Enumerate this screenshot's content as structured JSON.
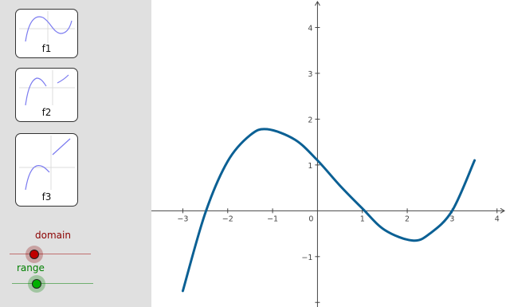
{
  "buttons": [
    {
      "label": "f1"
    },
    {
      "label": "f2"
    },
    {
      "label": "f3"
    }
  ],
  "sliders": {
    "domain": {
      "label": "domain",
      "color": "#8b0000",
      "fill": "#c00000"
    },
    "range": {
      "label": "range",
      "color": "#008000",
      "fill": "#00b000"
    }
  },
  "chart_data": {
    "type": "line",
    "title": "",
    "xlabel": "",
    "ylabel": "",
    "xlim": [
      -3.7,
      4.2
    ],
    "ylim": [
      -2.1,
      4.6
    ],
    "xticks": [
      -3,
      -2,
      -1,
      0,
      1,
      2,
      3,
      4
    ],
    "xtick_labels": [
      "−3",
      "−2",
      "−1",
      "0",
      "1",
      "2",
      "3",
      "4"
    ],
    "yticks": [
      -2,
      -1,
      1,
      2,
      3,
      4
    ],
    "ytick_labels": [
      "",
      "−1",
      "1",
      "2",
      "3",
      "4"
    ],
    "grid": false,
    "series": [
      {
        "color": "#0b6094",
        "x": [
          -3.0,
          -2.5,
          -2.0,
          -1.5,
          -1.12,
          -0.5,
          0.0,
          0.5,
          1.0,
          1.5,
          2.12,
          2.5,
          3.0,
          3.5
        ],
        "y": [
          -1.75,
          -0.05,
          1.08,
          1.65,
          1.78,
          1.55,
          1.1,
          0.55,
          0.05,
          -0.42,
          -0.65,
          -0.5,
          0.0,
          1.1
        ]
      }
    ]
  }
}
